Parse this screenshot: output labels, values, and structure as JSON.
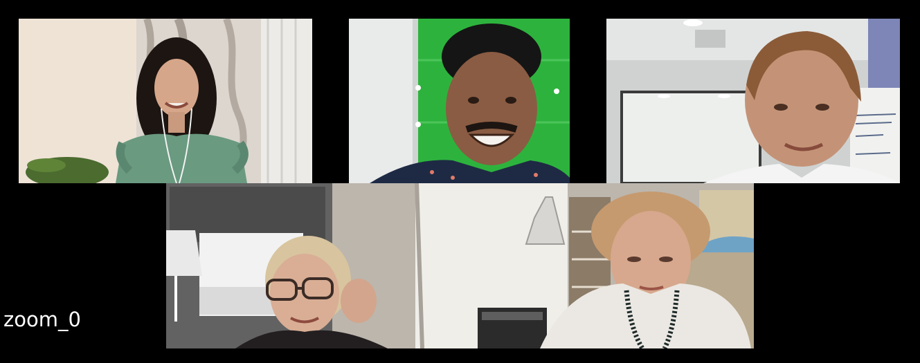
{
  "window": {
    "label": "zoom_0"
  },
  "gallery": {
    "participants": [
      {
        "id": "participant-1",
        "scene": "woman-curly-hair-green-top"
      },
      {
        "id": "participant-2",
        "scene": "man-smiling-green-screen"
      },
      {
        "id": "participant-3",
        "scene": "man-whiteboard-office"
      },
      {
        "id": "participant-4",
        "scene": "two-women-kitchen"
      }
    ]
  },
  "colors": {
    "background": "#000000",
    "label_text": "#ffffff"
  }
}
